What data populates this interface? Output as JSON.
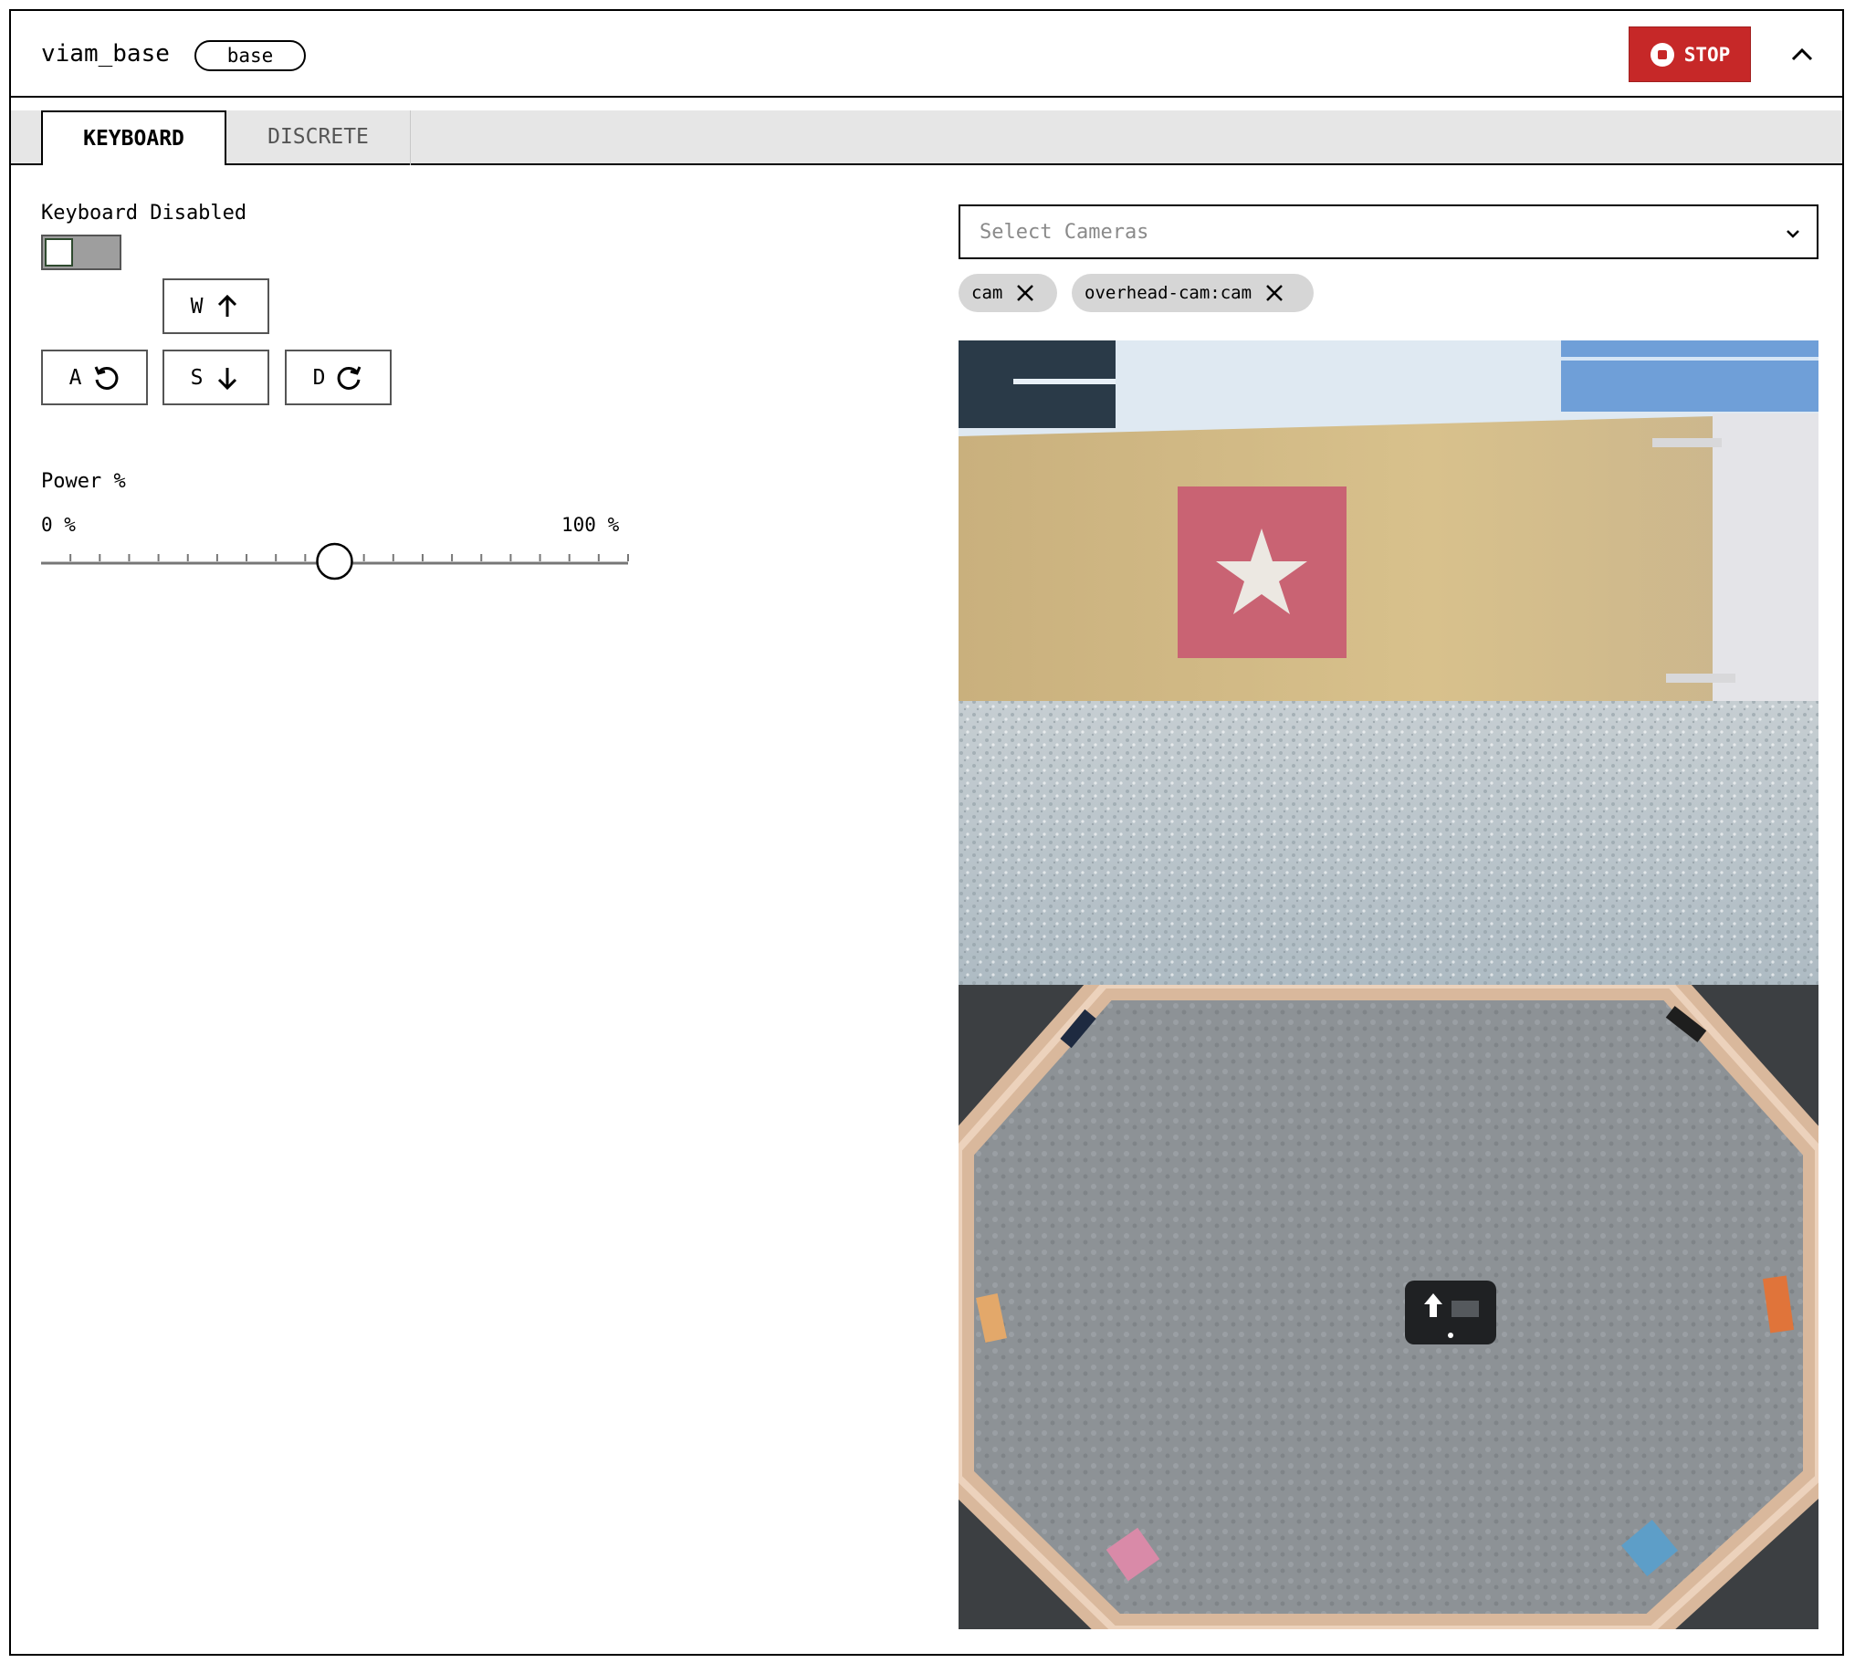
{
  "header": {
    "title": "viam_base",
    "badge": "base",
    "stop_label": "STOP"
  },
  "tabs": [
    {
      "label": "KEYBOARD",
      "active": true
    },
    {
      "label": "DISCRETE",
      "active": false
    }
  ],
  "keyboard": {
    "status_label": "Keyboard Disabled",
    "enabled": false,
    "keys": {
      "forward": "W",
      "left": "A",
      "backward": "S",
      "right": "D"
    }
  },
  "power": {
    "label": "Power %",
    "min_label": "0 %",
    "max_label": "100 %",
    "min": 0,
    "max": 100,
    "value": 50
  },
  "cameras": {
    "placeholder": "Select Cameras",
    "selected": [
      "cam",
      "overhead-cam:cam"
    ]
  },
  "colors": {
    "stop_red": "#c62828",
    "chip_gray": "#d6d6d6",
    "tabbar_gray": "#e6e6e6"
  }
}
